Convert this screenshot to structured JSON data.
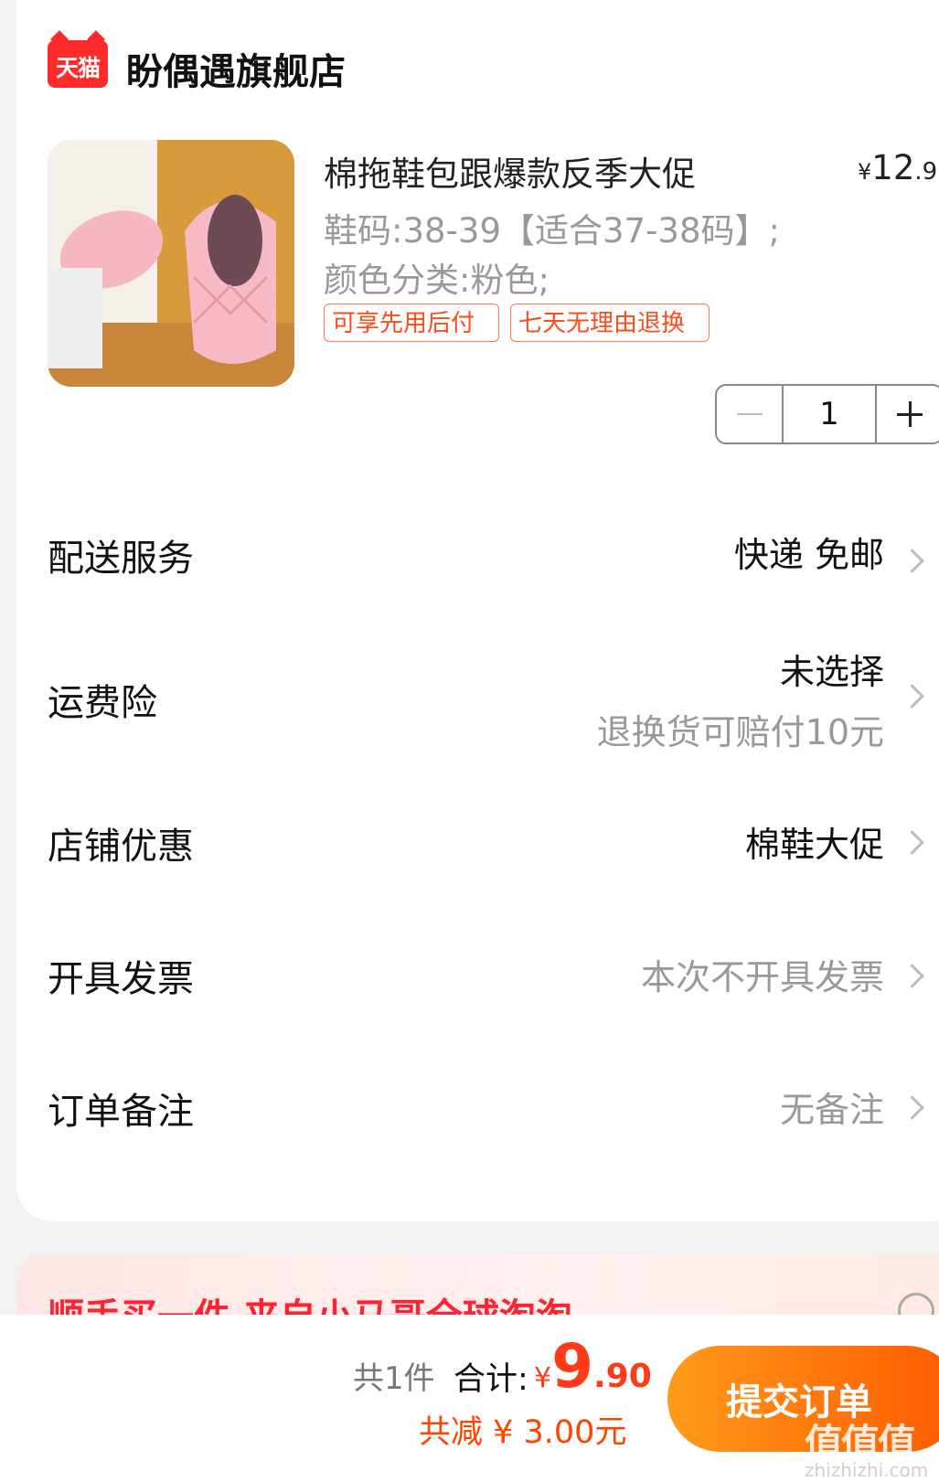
{
  "store": {
    "badge": "天猫",
    "name": "盼偶遇旗舰店"
  },
  "product": {
    "title": "棉拖鞋包跟爆款反季大促",
    "price_symbol": "¥",
    "price_int": "12",
    "price_dec": ".9",
    "sku_size": "鞋码:38-39【适合37-38码】;",
    "sku_color": "颜色分类:粉色;",
    "tags": [
      "可享先用后付",
      "七天无理由退换"
    ],
    "quantity": "1"
  },
  "rows": {
    "delivery": {
      "label": "配送服务",
      "value": "快递 免邮"
    },
    "shipping_insurance": {
      "label": "运费险",
      "value": "未选择",
      "sub": "退换货可赔付10元"
    },
    "store_discount": {
      "label": "店铺优惠",
      "value": "棉鞋大促"
    },
    "invoice": {
      "label": "开具发票",
      "value": "本次不开具发票"
    },
    "note": {
      "label": "订单备注",
      "value": "无备注"
    }
  },
  "promo": {
    "text": "顺手买一件 来自小马哥全球淘淘"
  },
  "footer": {
    "count": "共1件",
    "total_label": "合计:",
    "total_symbol": "¥",
    "total_int": "9",
    "total_dec": ".90",
    "discount": "共减 ¥ 3.00元",
    "submit": "提交订单"
  },
  "watermark": {
    "text": "值值值",
    "sub": "zhizhizhi.com"
  },
  "colors": {
    "accent": "#ff5a00",
    "price_red": "#ff3a1a",
    "tag_border": "#ff7a52"
  }
}
